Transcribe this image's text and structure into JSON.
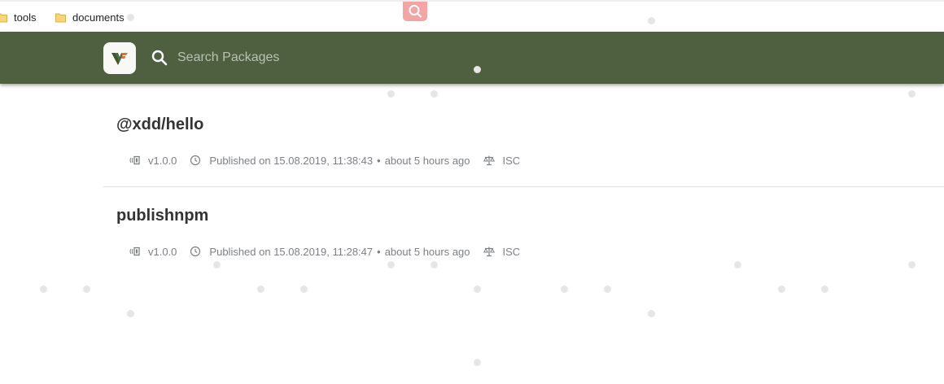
{
  "bookmarks": [
    {
      "label": "tools",
      "icon": "folder-icon"
    },
    {
      "label": "documents",
      "icon": "folder-icon"
    }
  ],
  "header": {
    "logo_icon": "verdaccio-logo-icon",
    "search_placeholder": "Search Packages",
    "search_value": "",
    "background_color": "#4f6041"
  },
  "packages": [
    {
      "name": "@xdd/hello",
      "version": "v1.0.0",
      "published_text": "Published on 15.08.2019, 11:38:43",
      "relative_time": "about 5 hours ago",
      "license": "ISC"
    },
    {
      "name": "publishnpm",
      "version": "v1.0.0",
      "published_text": "Published on 15.08.2019, 11:28:47",
      "relative_time": "about 5 hours ago",
      "license": "ISC"
    }
  ],
  "colors": {
    "meta_text": "#7b7f85",
    "package_name": "#333333",
    "floating_search": "#f3a4a4"
  }
}
